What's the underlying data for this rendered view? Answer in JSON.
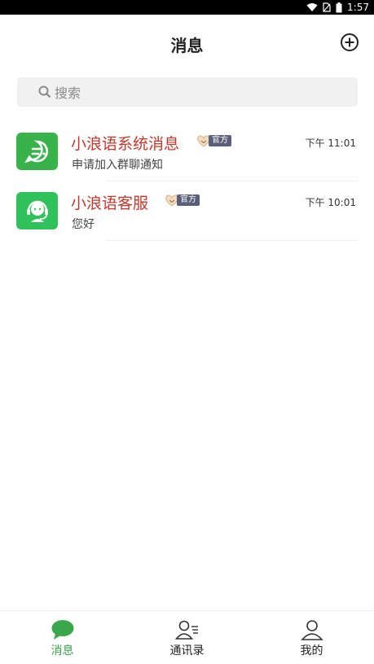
{
  "status_bar": {
    "time": "1:57"
  },
  "header": {
    "title": "消息"
  },
  "search": {
    "placeholder": "搜索"
  },
  "conversations": [
    {
      "name": "小浪语系统消息",
      "badge": "官方",
      "time": "下午 11:01",
      "preview": "申请加入群聊通知",
      "avatar_color": "#38b34a"
    },
    {
      "name": "小浪语客服",
      "badge": "官方",
      "time": "下午 10:01",
      "preview": "您好",
      "avatar_color": "#2fc15a"
    }
  ],
  "tabs": [
    {
      "label": "消息",
      "icon": "chat-bubble-icon",
      "active": true
    },
    {
      "label": "通讯录",
      "icon": "contacts-icon",
      "active": false
    },
    {
      "label": "我的",
      "icon": "profile-icon",
      "active": false
    }
  ],
  "colors": {
    "accent_green": "#3aa84a",
    "name_red": "#c0392b"
  }
}
